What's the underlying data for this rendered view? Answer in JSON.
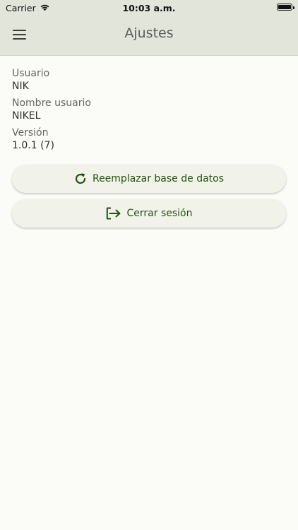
{
  "status_bar": {
    "carrier": "Carrier",
    "time": "10:03 a.m."
  },
  "header": {
    "title": "Ajustes",
    "menu_icon": "hamburger-menu-icon"
  },
  "info": [
    {
      "label": "Usuario",
      "value": "NIK"
    },
    {
      "label": "Nombre usuario",
      "value": "NIKEL"
    },
    {
      "label": "Versión",
      "value": "1.0.1 (7)"
    }
  ],
  "actions": {
    "replace_db": {
      "label": "Reemplazar base de datos",
      "icon": "refresh-icon"
    },
    "logout": {
      "label": "Cerrar sesión",
      "icon": "logout-icon"
    }
  },
  "colors": {
    "header_bg": "#e1e5da",
    "page_bg": "#fbfcf7",
    "accent": "#23530f",
    "button_bg": "#f1f3ea"
  }
}
